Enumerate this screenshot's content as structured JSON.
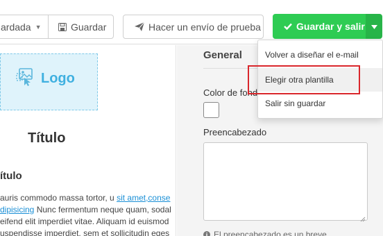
{
  "toolbar": {
    "status_label": "ardada",
    "save_label": "Guardar",
    "test_send_label": "Hacer un envío de prueba",
    "save_exit_label": "Guardar y salir"
  },
  "dropdown": {
    "items": [
      {
        "label": "Volver a diseñar el e-mail"
      },
      {
        "label": "Elegir otra plantilla"
      },
      {
        "label": "Salir sin guardar"
      }
    ]
  },
  "canvas": {
    "logo_label": "Logo",
    "title": "Título",
    "subtitle": "ítulo",
    "lines": [
      {
        "pre": "auris commodo massa tortor, u ",
        "link": "sit amet,conse",
        "post": ""
      },
      {
        "pre": "",
        "link": "dipisicing",
        "post": " Nunc fermentum neque quam, sodal"
      },
      {
        "pre": "eifend elit imperdiet vitae. Aliquam id euismod",
        "link": "",
        "post": ""
      },
      {
        "pre": "uspendisse imperdiet, sem et sollicitudin eges",
        "link": "",
        "post": ""
      }
    ]
  },
  "panel": {
    "section_title": "General",
    "background_color_label": "Color de fondo",
    "preheader_label": "Preencabezado",
    "preheader_value": "",
    "hint": "El preencabezado es un breve"
  },
  "colors": {
    "primary_green": "#2ecc53",
    "link_blue": "#1a8fd6",
    "highlight_red": "#d9262b"
  }
}
